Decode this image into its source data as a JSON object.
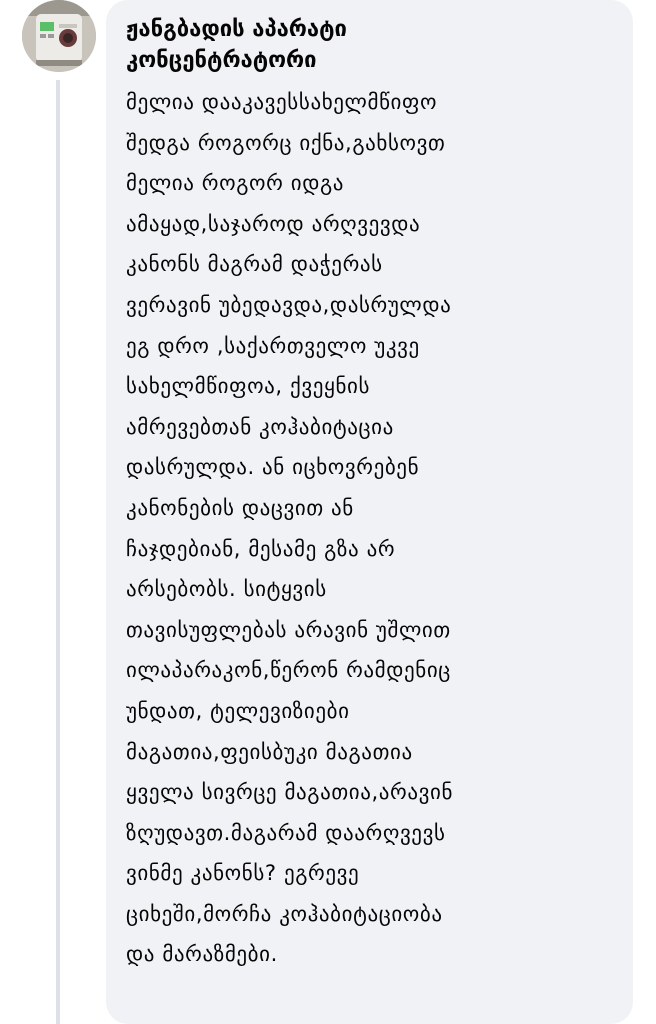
{
  "comment": {
    "author_line1": "ჟანგბადის აპარატი",
    "author_line2": "კონცენტრატორი",
    "text_lines": [
      "მელია დააკავესსახელმწიფო",
      "შედგა როგორც იქნა,გახსოვთ",
      "მელია როგორ იდგა",
      "ამაყად,საჯაროდ არღვევდა",
      "კანონს მაგრამ დაჭერას",
      "ვერავინ უბედავდა,დასრულდა",
      "ეგ დრო ,საქართველო უკვე",
      "სახელმწიფოა, ქვეყნის",
      "ამრევებთან კოჰაბიტაცია",
      "დასრულდა. ან იცხოვრებენ",
      "კანონების დაცვით ან",
      "ჩაჯდებიან, მესამე გზა არ",
      "არსებობს. სიტყვის",
      "თავისუფლებას არავინ უშლით",
      "ილაპარაკონ,წერონ რამდენიც",
      "უნდათ, ტელევიზიები",
      "მაგათია,ფეისბუკი მაგათია",
      "ყველა სივრცე მაგათია,არავინ",
      "ზღუდავთ.მაგარამ დაარღვევს",
      "ვინმე კანონს? ეგრევე",
      "ციხეში,მორჩა კოჰაბიტაციობა",
      "და მარაზმები."
    ]
  },
  "avatar": {
    "icon": "profile-photo"
  },
  "colors": {
    "bubble_background": "#f0f2f5",
    "text": "#050505",
    "thread_line": "#dde0e5"
  }
}
